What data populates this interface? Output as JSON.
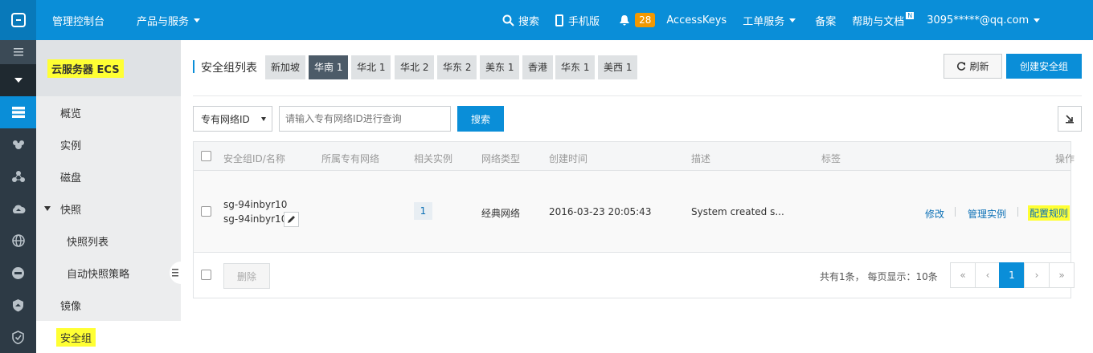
{
  "topbar": {
    "console": "管理控制台",
    "products": "产品与服务",
    "search": "搜索",
    "mobile": "手机版",
    "notif_count": "28",
    "accesskeys": "AccessKeys",
    "tickets": "工单服务",
    "beian": "备案",
    "help": "帮助与文档",
    "help_badge": "N",
    "user": "3095*****@qq.com"
  },
  "sidebar": {
    "title": "云服务器 ECS",
    "items": [
      "概览",
      "实例",
      "磁盘",
      "快照",
      "快照列表",
      "自动快照策略",
      "镜像",
      "安全组"
    ]
  },
  "main": {
    "list_title": "安全组列表",
    "regions": [
      "新加坡",
      "华南 1",
      "华北 1",
      "华北 2",
      "华东 2",
      "美东 1",
      "香港",
      "华东 1",
      "美西 1"
    ],
    "active_region": "华南 1",
    "refresh": "刷新",
    "create": "创建安全组",
    "filter_select": "专有网络ID",
    "filter_placeholder": "请输入专有网络ID进行查询",
    "search_btn": "搜索",
    "headers": [
      "安全组ID/名称",
      "所属专有网络",
      "相关实例",
      "网络类型",
      "创建时间",
      "描述",
      "标签",
      "操作"
    ],
    "row": {
      "id": "sg-94inbyr10",
      "name": "sg-94inbyr10",
      "instances": "1",
      "network": "经典网络",
      "created": "2016-03-23 20:05:43",
      "desc": "System created s...",
      "act_modify": "修改",
      "act_manage": "管理实例",
      "act_rules": "配置规则"
    },
    "delete_btn": "删除",
    "pager_info": "共有1条， 每页显示：10条",
    "pager": {
      "first": "«",
      "prev": "‹",
      "current": "1",
      "next": "›",
      "last": "»"
    }
  },
  "colors": {
    "topbar": "#0a8ed8",
    "iconbar": "#2d3a45",
    "sidebar": "#ecedee",
    "primary_btn": "#0a8ed8",
    "highlight": "#ffff33",
    "active_region": "#4c5b68"
  }
}
